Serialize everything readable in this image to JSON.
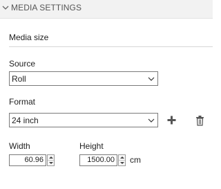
{
  "header": {
    "title": "MEDIA SETTINGS",
    "expand_icon": "chevron-down-icon"
  },
  "section": {
    "title": "Media size"
  },
  "source": {
    "label": "Source",
    "selected": "Roll"
  },
  "format": {
    "label": "Format",
    "selected": "24 inch",
    "add_icon": "plus-icon",
    "delete_icon": "trash-icon"
  },
  "width": {
    "label": "Width",
    "value": "60.96"
  },
  "height": {
    "label": "Height",
    "value": "1500.00",
    "unit": "cm"
  },
  "colors": {
    "header_bg": "#f2f2f2",
    "border": "#7a7a7a",
    "icon": "#555555"
  }
}
